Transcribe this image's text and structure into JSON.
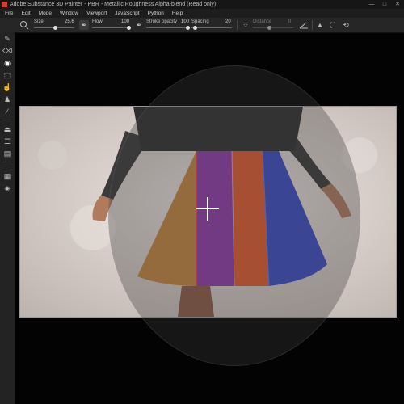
{
  "window": {
    "title": "Adobe Substance 3D Painter - PBR - Metallic Roughness Alpha-blend (Read only)",
    "buttons": [
      "—",
      "□",
      "✕"
    ]
  },
  "menu": [
    "File",
    "Edit",
    "Mode",
    "Window",
    "Viewport",
    "JavaScript",
    "Python",
    "Help"
  ],
  "toolbar": {
    "size_label": "Size",
    "size_value": "25.6",
    "flow_label": "Flow",
    "flow_value": "100",
    "stroke_opacity_label": "Stroke opacity",
    "stroke_opacity_value": "100",
    "spacing_label": "Spacing",
    "spacing_value": "20",
    "distance_label": "Distance",
    "distance_value": "0"
  },
  "viewport": {
    "document": "Flared skirt with orange, purple, red and blue woven fabric panels"
  },
  "colors": {
    "accent": "#d63c2f",
    "panel": "#262626",
    "viewport_bg": "#030303"
  }
}
